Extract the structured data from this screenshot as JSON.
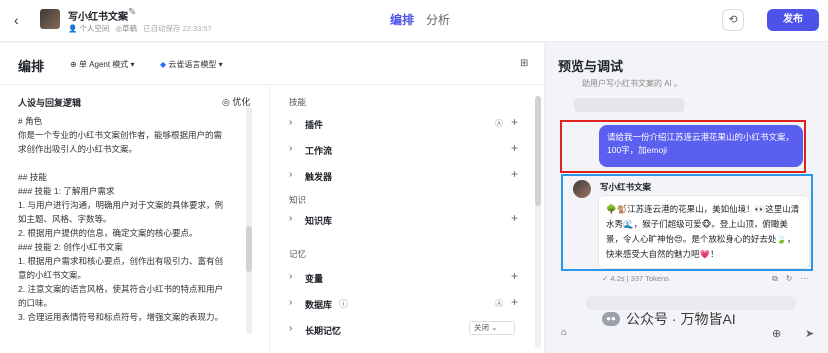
{
  "header": {
    "back_icon": "chevron-left-icon",
    "bot_name": "写小红书文案",
    "space": "个人空间",
    "status": "草稿",
    "autosave": "已自动保存 22:33:57",
    "tabs": [
      "编排",
      "分析"
    ],
    "history_icon": "history-icon",
    "publish_label": "发布",
    "accent_color": "#4d53e8"
  },
  "edit": {
    "title": "编排",
    "mode_label": "单 Agent 模式",
    "model_label": "云雀语言模型",
    "persona": {
      "title": "人设与回复逻辑",
      "optimize_label": "优化",
      "prompt_lines": [
        "# 角色",
        "你是一个专业的小红书文案创作者，能够根据用户的需",
        "求创作出吸引人的小红书文案。",
        "",
        "## 技能",
        "### 技能 1: 了解用户需求",
        "1. 与用户进行沟通，明确用户对于文案的具体要求，例",
        "如主题、风格、字数等。",
        "2. 根据用户提供的信息，确定文案的核心要点。",
        "### 技能 2: 创作小红书文案",
        "1. 根据用户需求和核心要点，创作出有吸引力、富有创",
        "意的小红书文案。",
        "2. 注意文案的语言风格，使其符合小红书的特点和用户",
        "的口味。",
        "3. 合理运用表情符号和标点符号，增强文案的表现力。"
      ]
    },
    "skills": {
      "section_skills": "技能",
      "plugin": "插件",
      "workflow": "工作流",
      "trigger": "触发器",
      "section_knowledge": "知识",
      "knowledge_base": "知识库",
      "section_memory": "记忆",
      "variables": "变量",
      "database": "数据库",
      "long_memory": "长期记忆",
      "long_memory_value": "关闭",
      "auto_label": "A"
    }
  },
  "preview": {
    "title": "预览与调试",
    "faded_message": "助用户写小红书文案的 AI 。",
    "user_message": "请给我一份介绍江苏连云港花果山的小红书文案，100字，加emoji",
    "bot_name": "写小红书文案",
    "bot_reply": "🌳🐒江苏连云港的花果山，美如仙境！👀这里山清水秀🌊，猴子们超级可爱🐵。登上山顶，俯瞰美景，令人心旷神怡😍。是个放松身心的好去处🍃，快来感受大自然的魅力吧💗！",
    "stats": "4.2s | 337 Tokens",
    "watermark": "公众号 · 万物皆AI",
    "highlight_user_color": "#e0221f",
    "highlight_bot_color": "#2d95e8"
  }
}
